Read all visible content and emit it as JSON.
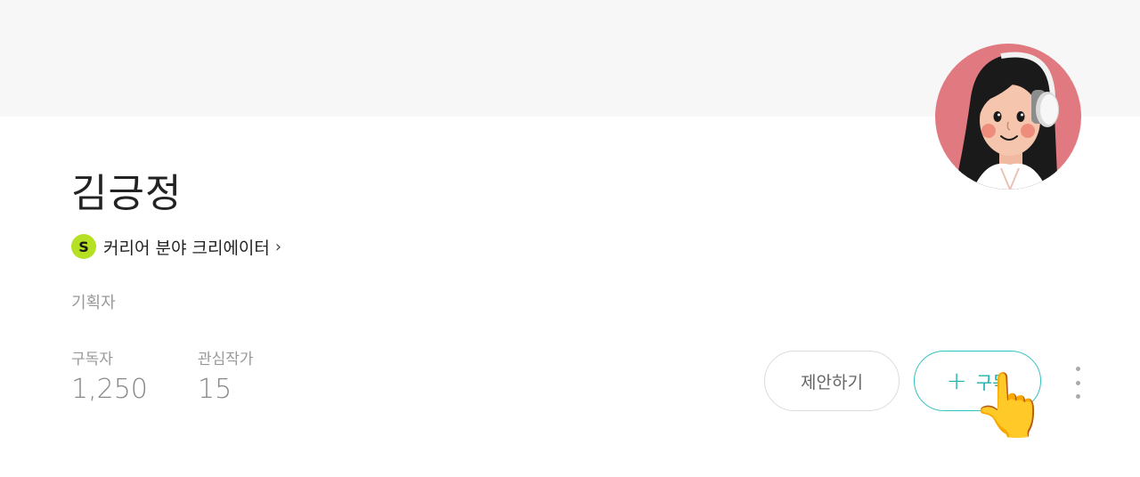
{
  "profile": {
    "name": "김긍정",
    "creator_badge": "S",
    "creator_label": "커리어 분야 크리에이터",
    "creator_chevron": "›",
    "job": "기획자"
  },
  "stats": {
    "subscribers_label": "구독자",
    "subscribers_value": "1,250",
    "interests_label": "관심작가",
    "interests_value": "15"
  },
  "actions": {
    "suggest_label": "제안하기",
    "subscribe_plus": "+",
    "subscribe_label": "구독",
    "pointer_emoji": "👆",
    "more_icon": "more-vertical-icon"
  },
  "colors": {
    "accent": "#2fc3c0",
    "creator_badge": "#b5e024",
    "banner": "#f7f7f7",
    "avatar_bg": "#e07a80"
  }
}
